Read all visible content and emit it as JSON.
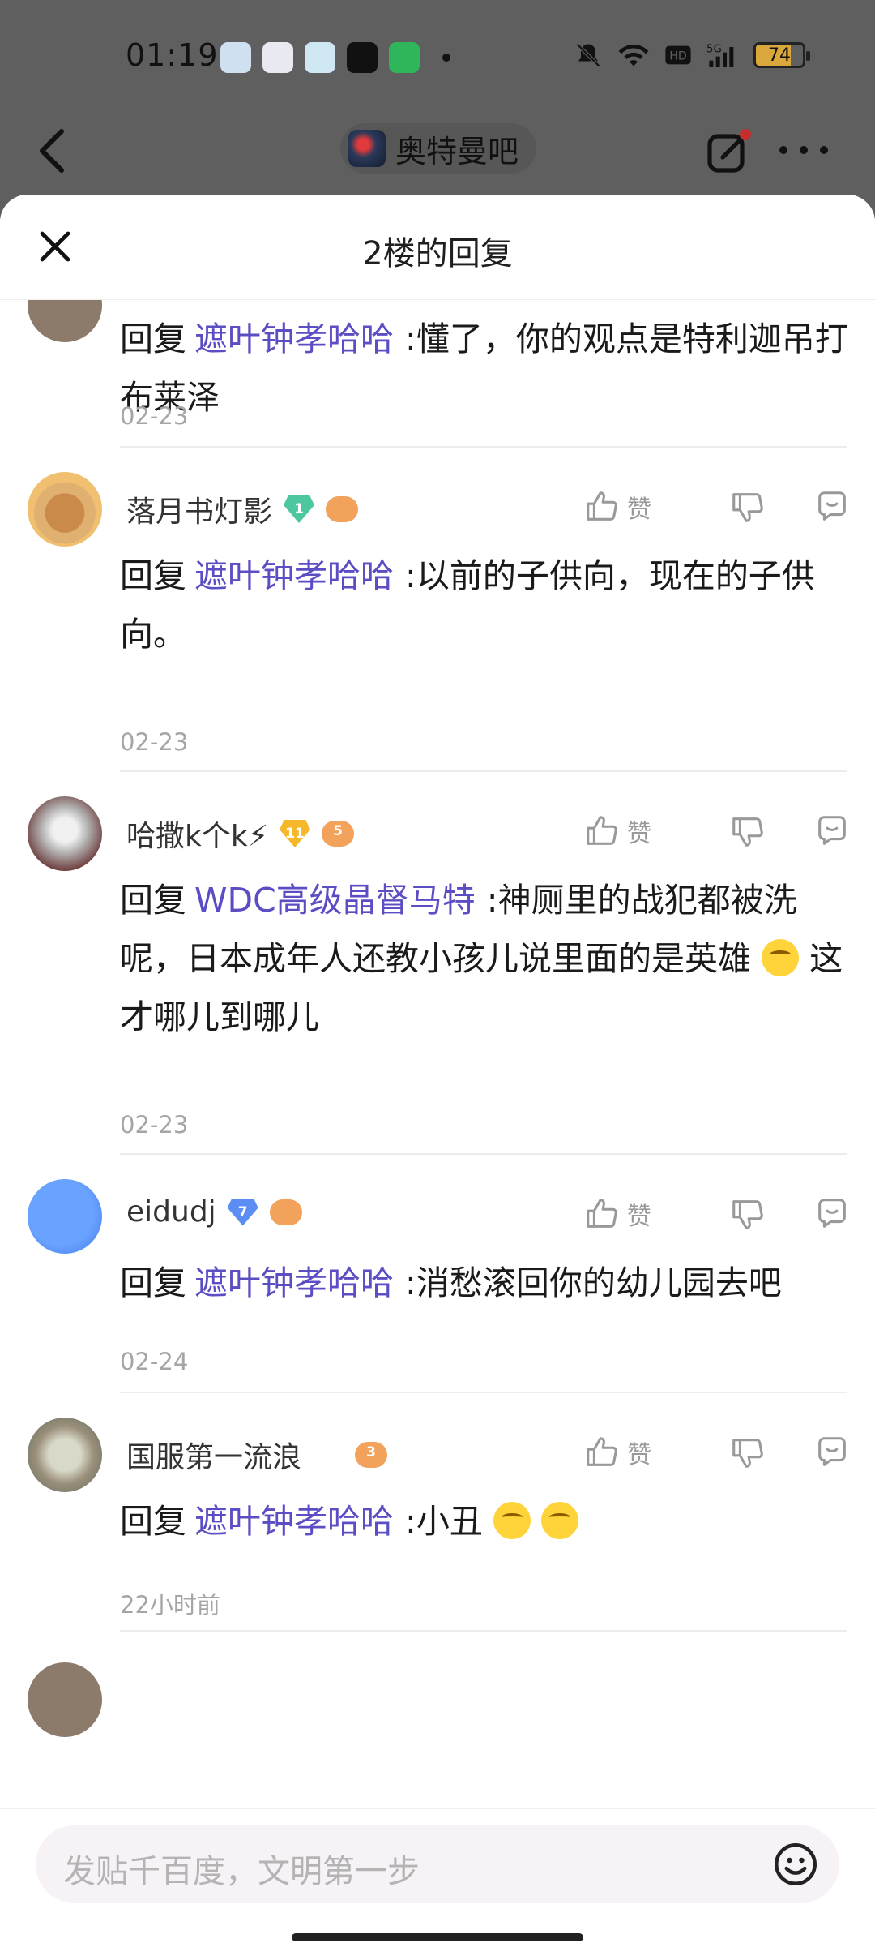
{
  "status": {
    "time": "01:19",
    "battery": "74",
    "net": "5G"
  },
  "nav": {
    "forum_name": "奥特曼吧"
  },
  "sheet": {
    "title": "2楼的回复"
  },
  "partial_comment": {
    "reply_prefix": "回复",
    "target": "遮叶钟孝哈哈",
    "text": ":懂了，你的观点是特利迦吊打布莱泽",
    "date": "02-23"
  },
  "comments": [
    {
      "username": "落月书灯影",
      "level": "1",
      "game_level": "",
      "reply_prefix": "回复",
      "target": "遮叶钟孝哈哈",
      "text": ":以前的子供向，现在的子供向。",
      "date": "02-23",
      "like_label": "赞"
    },
    {
      "username": "哈撒k个k⚡",
      "level": "11",
      "game_level": "5",
      "reply_prefix": "回复",
      "target": "WDC高级晶督马特",
      "text": ":神厕里的战犯都被洗呢，日本成年人还教小孩儿说里面的是英雄",
      "text_after": "这才哪儿到哪儿",
      "date": "02-23",
      "like_label": "赞"
    },
    {
      "username": "eidudj",
      "level": "7",
      "game_level": "",
      "reply_prefix": "回复",
      "target": "遮叶钟孝哈哈",
      "text": ":消愁滚回你的幼儿园去吧",
      "date": "02-24",
      "like_label": "赞"
    },
    {
      "username": "国服第一流浪",
      "level": "",
      "game_level": "3",
      "reply_prefix": "回复",
      "target": "遮叶钟孝哈哈",
      "text": ":小丑",
      "date": "22小时前",
      "like_label": "赞"
    }
  ],
  "input": {
    "placeholder": "发贴千百度，文明第一步"
  },
  "colors": {
    "link": "#5b4ec5",
    "date": "#a5a5a5"
  }
}
